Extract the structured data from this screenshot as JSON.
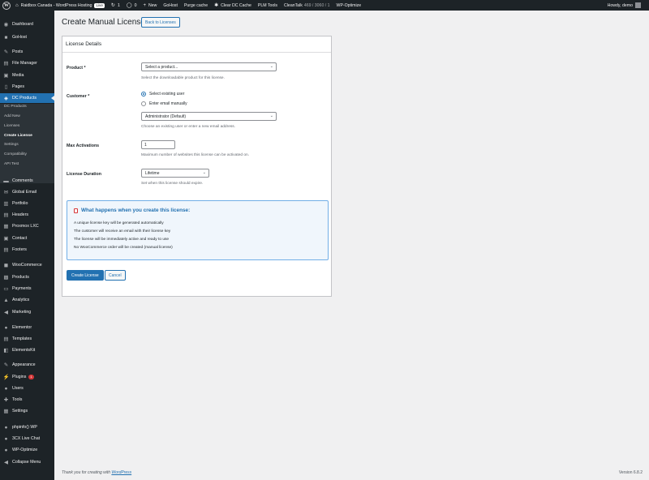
{
  "admin_bar": {
    "site_name": "Raidbox Canada - WordPress Hosting",
    "live_badge": "Live",
    "updates_count": "1",
    "comments_count": "0",
    "new_label": "New",
    "gohost_label": "GoHost",
    "purge_cache_label": "Purge cache",
    "clear_cache_label": "Clear DC Cache",
    "plm_tools_label": "PLM Tools",
    "cleantalk_label": "CleanTalk",
    "cleantalk_stats": "469 / 3060 / 1",
    "wp_optimize_label": "WP-Optimize",
    "greeting": "Howdy, demo"
  },
  "sidebar": {
    "items": [
      {
        "label": "Dashboard",
        "icon": "dashboard-icon",
        "glyph": "◉"
      },
      {
        "label": "GoHost",
        "icon": "gohost-icon",
        "glyph": "■"
      },
      {
        "label": "Posts",
        "icon": "pin-icon",
        "glyph": "✎"
      },
      {
        "label": "File Manager",
        "icon": "folder-icon",
        "glyph": "▤"
      },
      {
        "label": "Media",
        "icon": "media-icon",
        "glyph": "▣"
      },
      {
        "label": "Pages",
        "icon": "page-icon",
        "glyph": "▯"
      },
      {
        "label": "DC Products",
        "icon": "products-icon",
        "glyph": "◈"
      },
      {
        "label": "Comments",
        "icon": "comment-icon",
        "glyph": "▬"
      },
      {
        "label": "Global Email",
        "icon": "email-icon",
        "glyph": "✉"
      },
      {
        "label": "Portfolio",
        "icon": "portfolio-icon",
        "glyph": "▥"
      },
      {
        "label": "Headers",
        "icon": "header-icon",
        "glyph": "▤"
      },
      {
        "label": "Proxmox LXC",
        "icon": "server-icon",
        "glyph": "▦"
      },
      {
        "label": "Contact",
        "icon": "contact-icon",
        "glyph": "▣"
      },
      {
        "label": "Footers",
        "icon": "footer-icon",
        "glyph": "▤"
      },
      {
        "label": "WooCommerce",
        "icon": "woocommerce-icon",
        "glyph": "◼"
      },
      {
        "label": "Products",
        "icon": "box-icon",
        "glyph": "▩"
      },
      {
        "label": "Payments",
        "icon": "payments-icon",
        "glyph": "▭"
      },
      {
        "label": "Analytics",
        "icon": "analytics-icon",
        "glyph": "▲"
      },
      {
        "label": "Marketing",
        "icon": "megaphone-icon",
        "glyph": "◀"
      },
      {
        "label": "Elementor",
        "icon": "elementor-icon",
        "glyph": "●"
      },
      {
        "label": "Templates",
        "icon": "templates-icon",
        "glyph": "▤"
      },
      {
        "label": "ElementsKit",
        "icon": "elementskit-icon",
        "glyph": "◧"
      },
      {
        "label": "Appearance",
        "icon": "brush-icon",
        "glyph": "✎"
      },
      {
        "label": "Plugins",
        "icon": "plugin-icon",
        "glyph": "⚡"
      },
      {
        "label": "Users",
        "icon": "users-icon",
        "glyph": "●"
      },
      {
        "label": "Tools",
        "icon": "wrench-icon",
        "glyph": "✚"
      },
      {
        "label": "Settings",
        "icon": "settings-icon",
        "glyph": "▦"
      },
      {
        "label": "phpinfo() WP",
        "icon": "info-icon",
        "glyph": "●"
      },
      {
        "label": "3CX Live Chat",
        "icon": "chat-icon",
        "glyph": "●"
      },
      {
        "label": "WP-Optimize",
        "icon": "optimize-icon",
        "glyph": "●"
      },
      {
        "label": "Collapse Menu",
        "icon": "collapse-icon",
        "glyph": "◀"
      }
    ],
    "plugins_badge": "1",
    "submenu": [
      "DC Products",
      "Add New",
      "Licenses",
      "Create License",
      "Settings",
      "Compatibility",
      "API Test"
    ]
  },
  "page": {
    "title": "Create Manual License",
    "back_button": "Back to Licenses",
    "card_title": "License Details",
    "product": {
      "label": "Product *",
      "value": "Select a product...",
      "description": "Select the downloadable product for this license."
    },
    "customer": {
      "label": "Customer *",
      "option_existing": "Select existing user",
      "option_email": "Enter email manually",
      "selected_user": "Administrator (Default)",
      "description": "Choose an existing user or enter a new email address."
    },
    "max_activations": {
      "label": "Max Activations",
      "value": "1",
      "description": "Maximum number of websites this license can be activated on."
    },
    "license_duration": {
      "label": "License Duration",
      "value": "Lifetime",
      "description": "Set when this license should expire."
    },
    "info": {
      "title": "What happens when you create this license:",
      "lines": [
        "A unique license key will be generated automatically",
        "The customer will receive an email with their license key",
        "The license will be immediately active and ready to use",
        "No WooCommerce order will be created (manual license)"
      ]
    },
    "create_button": "Create License",
    "cancel_button": "Cancel"
  },
  "footer": {
    "thanks_prefix": "Thank you for creating with",
    "wordpress_link": "WordPress",
    "version": "Version 6.8.2"
  }
}
